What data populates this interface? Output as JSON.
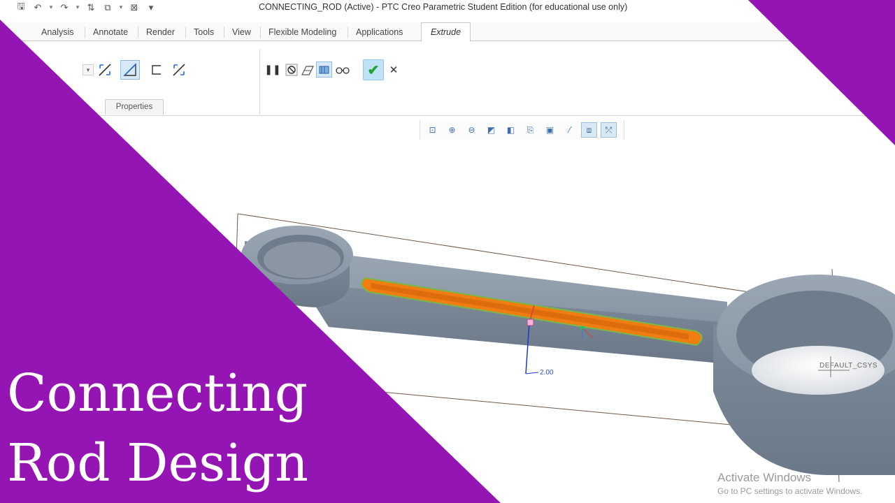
{
  "window": {
    "title": "CONNECTING_ROD (Active) - PTC Creo Parametric Student Edition (for educational use only)"
  },
  "quick_access": [
    {
      "icon": "save-icon",
      "glyph": "🖫"
    },
    {
      "icon": "undo-icon",
      "glyph": "↶"
    },
    {
      "icon": "redo-icon",
      "glyph": "↷"
    },
    {
      "icon": "regenerate-icon",
      "glyph": "⇅"
    },
    {
      "icon": "windows-icon",
      "glyph": "⧉"
    },
    {
      "icon": "close-window-icon",
      "glyph": "⊠"
    },
    {
      "icon": "customize-icon",
      "glyph": "▾"
    }
  ],
  "ribbon": {
    "tabs": [
      "Analysis",
      "Annotate",
      "Render",
      "Tools",
      "View",
      "Flexible Modeling",
      "Applications"
    ],
    "active_tab": "Extrude",
    "properties_tab": "Properties"
  },
  "extrude_controls": {
    "pause_glyph": "❚❚",
    "confirm_glyph": "✔",
    "cancel_glyph": "✕"
  },
  "graphics_toolbar": [
    {
      "icon": "refit-icon",
      "glyph": "⊡"
    },
    {
      "icon": "zoom-in-icon",
      "glyph": "⊕"
    },
    {
      "icon": "zoom-out-icon",
      "glyph": "⊖"
    },
    {
      "icon": "repaint-icon",
      "glyph": "◩"
    },
    {
      "icon": "display-style-icon",
      "glyph": "◧"
    },
    {
      "icon": "saved-orientations-icon",
      "glyph": "⎘"
    },
    {
      "icon": "view-manager-icon",
      "glyph": "▣"
    },
    {
      "icon": "datum-display-icon",
      "glyph": "⁄"
    },
    {
      "icon": "annotation-display-icon",
      "glyph": "⧈"
    },
    {
      "icon": "spin-center-icon",
      "glyph": "⤱"
    }
  ],
  "viewport": {
    "dimension_value": "2.00",
    "csys_label": "DEFAULT_CSYS",
    "part_color": "#8e9aa7",
    "cut_color": "#f07d12"
  },
  "watermark": {
    "title": "Activate Windows",
    "subtitle": "Go to PC settings to activate Windows."
  },
  "thumbnail": {
    "line1": "Connecting",
    "line2": "Rod Design",
    "accent_color": "#9414b4"
  }
}
